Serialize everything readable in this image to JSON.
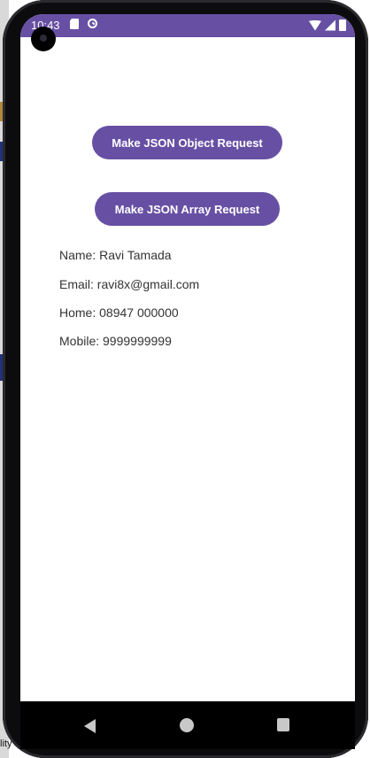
{
  "status_bar": {
    "time": "10:43",
    "color": "#6750a4"
  },
  "buttons": {
    "object_request_label": "Make JSON Object Request",
    "array_request_label": "Make JSON Array Request",
    "color": "#6750a4"
  },
  "contact": {
    "name": "Name: Ravi Tamada",
    "email": "Email: ravi8x@gmail.com",
    "home": "Home: 08947 000000",
    "mobile": "Mobile: 9999999999"
  },
  "desktop": {
    "edge_text": "lity"
  },
  "icons": [
    "sd-card-icon",
    "sync-icon",
    "wifi-icon",
    "signal-icon",
    "battery-icon",
    "back-icon",
    "home-icon",
    "recents-icon"
  ]
}
